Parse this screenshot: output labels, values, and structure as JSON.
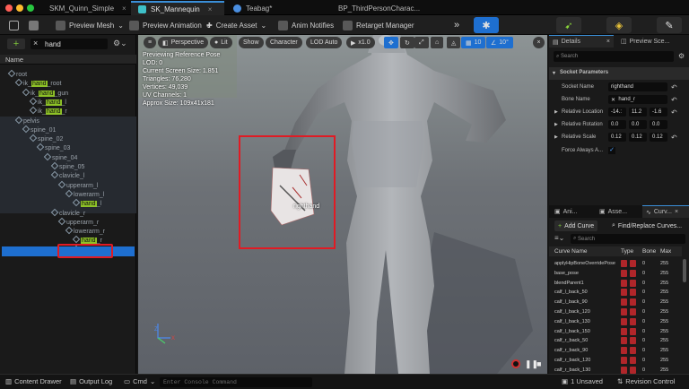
{
  "titlebar": {
    "tabs": [
      {
        "label": "SKM_Quinn_Simple",
        "color": "#c6a340"
      },
      {
        "label": "SK_Mannequin",
        "color": "#3ec0c8"
      },
      {
        "label": "Teabag*",
        "color": "#4a8ee0"
      },
      {
        "label": "BP_ThirdPersonCharac...",
        "color": "#5aa6e8"
      }
    ]
  },
  "toolbar": {
    "preview_mesh": "Preview Mesh",
    "preview_animation": "Preview Animation",
    "create_asset": "Create Asset",
    "anim_notifies": "Anim Notifies",
    "retarget_manager": "Retarget Manager"
  },
  "skeleton_tree": {
    "search_value": "hand",
    "column_header": "Name",
    "rows": [
      {
        "pre": "",
        "hit": "",
        "post": "root",
        "indent": 10,
        "match": false
      },
      {
        "pre": "ik_",
        "hit": "hand",
        "post": "_root",
        "indent": 18,
        "match": true
      },
      {
        "pre": "ik_",
        "hit": "hand",
        "post": "_gun",
        "indent": 26,
        "match": true
      },
      {
        "pre": "ik_",
        "hit": "hand",
        "post": "_l",
        "indent": 34,
        "match": true
      },
      {
        "pre": "ik_",
        "hit": "hand",
        "post": "_r",
        "indent": 34,
        "match": true
      },
      {
        "pre": "",
        "hit": "",
        "post": "pelvis",
        "indent": 18,
        "match": false
      },
      {
        "pre": "",
        "hit": "",
        "post": "spine_01",
        "indent": 26,
        "match": false
      },
      {
        "pre": "",
        "hit": "",
        "post": "spine_02",
        "indent": 34,
        "match": false
      },
      {
        "pre": "",
        "hit": "",
        "post": "spine_03",
        "indent": 42,
        "match": false
      },
      {
        "pre": "",
        "hit": "",
        "post": "spine_04",
        "indent": 50,
        "match": false
      },
      {
        "pre": "",
        "hit": "",
        "post": "spine_05",
        "indent": 58,
        "match": false
      },
      {
        "pre": "",
        "hit": "",
        "post": "clavicle_l",
        "indent": 58,
        "match": false
      },
      {
        "pre": "",
        "hit": "",
        "post": "upperarm_l",
        "indent": 66,
        "match": false
      },
      {
        "pre": "",
        "hit": "",
        "post": "lowerarm_l",
        "indent": 74,
        "match": false
      },
      {
        "pre": "",
        "hit": "hand",
        "post": "_l",
        "indent": 82,
        "match": true
      },
      {
        "pre": "",
        "hit": "",
        "post": "clavicle_r",
        "indent": 58,
        "match": false
      },
      {
        "pre": "",
        "hit": "",
        "post": "upperarm_r",
        "indent": 66,
        "match": false
      },
      {
        "pre": "",
        "hit": "",
        "post": "lowerarm_r",
        "indent": 74,
        "match": false
      },
      {
        "pre": "",
        "hit": "hand",
        "post": "_r",
        "indent": 82,
        "match": true
      },
      {
        "pre": "right",
        "hit": "hand",
        "post": "",
        "indent": 82,
        "match": true
      }
    ]
  },
  "viewport": {
    "perspective": "Perspective",
    "lit": "Lit",
    "show": "Show",
    "character": "Character",
    "lod": "LOD Auto",
    "speed": "x1.0",
    "grid": "10",
    "angle": "10°",
    "stats": [
      "Previewing Reference Pose",
      "LOD: 0",
      "Current Screen Size: 1.851",
      "Triangles: 76,280",
      "Vertices: 49,039",
      "UV Channels: 1",
      "Approx Size: 109x41x181"
    ],
    "socket_label": "righthand"
  },
  "details": {
    "tab_details": "Details",
    "tab_preview": "Preview Sce...",
    "search_placeholder": "Search",
    "section": "Socket Parameters",
    "socket_name_label": "Socket Name",
    "socket_name": "righthand",
    "bone_name_label": "Bone Name",
    "bone_name": "hand_r",
    "rel_location_label": "Relative Location",
    "rel_location": [
      "-14.:",
      "11.2",
      "-1.6"
    ],
    "rel_rotation_label": "Relative Rotation",
    "rel_rotation": [
      "0.0",
      "0.0",
      "0.0"
    ],
    "rel_scale_label": "Relative Scale",
    "rel_scale": [
      "0.12",
      "0.12",
      "0.12"
    ],
    "force_label": "Force Always A..."
  },
  "curves": {
    "tab_ani": "Ani...",
    "tab_asse": "Asse...",
    "tab_curv": "Curv...",
    "add_curve": "Add Curve",
    "find_replace": "Find/Replace Curves...",
    "search_placeholder": "Search",
    "headers": [
      "Curve Name",
      "Type",
      "Bone",
      "Max"
    ],
    "rows": [
      {
        "name": "applyHipBoneOverridePose",
        "bone": "0",
        "max": "255"
      },
      {
        "name": "base_pose",
        "bone": "0",
        "max": "255"
      },
      {
        "name": "blendParent1",
        "bone": "0",
        "max": "255"
      },
      {
        "name": "calf_l_back_50",
        "bone": "0",
        "max": "255"
      },
      {
        "name": "calf_l_back_90",
        "bone": "0",
        "max": "255"
      },
      {
        "name": "calf_l_back_120",
        "bone": "0",
        "max": "255"
      },
      {
        "name": "calf_l_back_130",
        "bone": "0",
        "max": "255"
      },
      {
        "name": "calf_l_back_150",
        "bone": "0",
        "max": "255"
      },
      {
        "name": "calf_r_back_50",
        "bone": "0",
        "max": "255"
      },
      {
        "name": "calf_r_back_90",
        "bone": "0",
        "max": "255"
      },
      {
        "name": "calf_r_back_120",
        "bone": "0",
        "max": "255"
      },
      {
        "name": "calf_r_back_130",
        "bone": "0",
        "max": "255"
      }
    ]
  },
  "status": {
    "content_drawer": "Content Drawer",
    "output_log": "Output Log",
    "cmd": "Cmd",
    "console_placeholder": "Enter Console Command",
    "unsaved": "1 Unsaved",
    "revision": "Revision Control"
  },
  "colors": {
    "accent": "#3a8fd8",
    "highlight": "#8ec227",
    "annotation": "#e01b24",
    "selection": "#1e6fd0"
  }
}
